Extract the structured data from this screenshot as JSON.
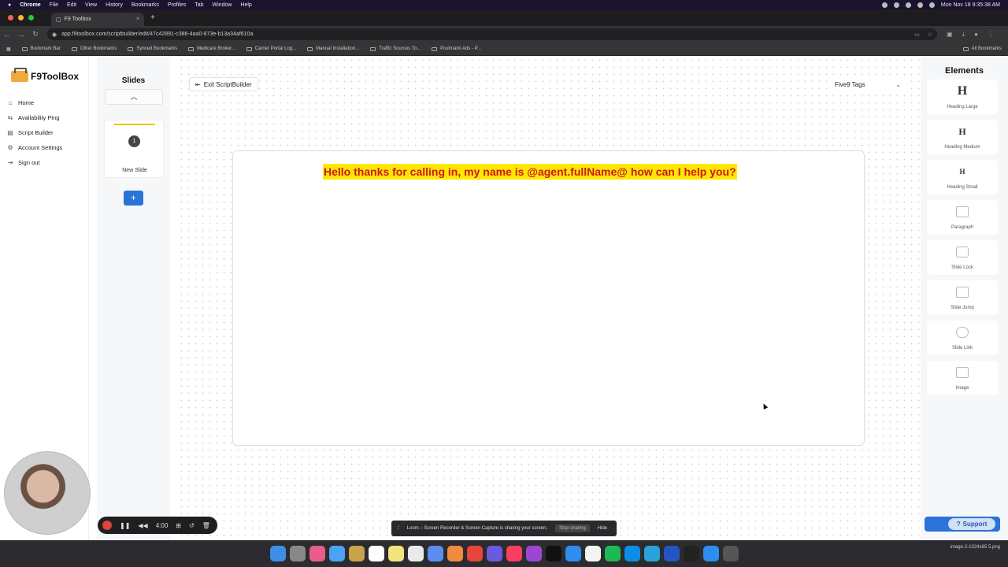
{
  "menubar": {
    "app": "Chrome",
    "items": [
      "File",
      "Edit",
      "View",
      "History",
      "Bookmarks",
      "Profiles",
      "Tab",
      "Window",
      "Help"
    ],
    "clock": "Mon Nov 18  9:35:38 AM"
  },
  "browser": {
    "tab_title": "F9 Toolbox",
    "url": "app.f9toolbox.com/scriptbuilder/edit/47c42891-c386-4aa0-873e-b13a34af610a",
    "bookmarks": [
      "Bookmark Bar",
      "Other Bookmarks",
      "Synced Bookmarks",
      "Medicare Broker...",
      "Carrier Portal Log...",
      "Manual Installation...",
      "Traffic Sources To...",
      "Pushnami Ads - P..."
    ],
    "all_bookmarks": "All Bookmarks"
  },
  "sidebar": {
    "logo": "F9ToolBox",
    "items": [
      {
        "label": "Home",
        "icon": "home-icon"
      },
      {
        "label": "Availability Ping",
        "icon": "ping-icon"
      },
      {
        "label": "Script Builder",
        "icon": "document-icon"
      },
      {
        "label": "Account Settings",
        "icon": "gear-icon"
      },
      {
        "label": "Sign out",
        "icon": "signout-icon"
      }
    ]
  },
  "slides_panel": {
    "title": "Slides",
    "slides": [
      {
        "number": "1",
        "label": "New Slide"
      }
    ],
    "add_label": "+"
  },
  "editor": {
    "exit_label": "Exit ScriptBuilder",
    "tags_label": "Five9 Tags",
    "headline": "Hello thanks for calling in, my name is @agent.fullName@ how can I help you?",
    "headline_bg": "#ffe800",
    "headline_color": "#d0141e"
  },
  "elements_panel": {
    "title": "Elements",
    "items": [
      {
        "label": "Heading Large",
        "glyph": "H"
      },
      {
        "label": "Heading Medium",
        "glyph": "H"
      },
      {
        "label": "Heading Small",
        "glyph": "H"
      },
      {
        "label": "Paragraph",
        "glyph": ""
      },
      {
        "label": "Slide Lock",
        "glyph": ""
      },
      {
        "label": "Slide Jump",
        "glyph": ""
      },
      {
        "label": "Slide Link",
        "glyph": ""
      },
      {
        "label": "Image",
        "glyph": ""
      }
    ]
  },
  "support": {
    "label": "Support"
  },
  "recorder": {
    "time": "4:00"
  },
  "loom": {
    "message": "Loom – Screen Recorder & Screen Capture is sharing your screen.",
    "stop": "Stop sharing",
    "hide": "Hide"
  },
  "dock": {
    "file_label": "image-2-1024x65 5.png"
  },
  "colors": {
    "accent": "#2a73d9"
  }
}
